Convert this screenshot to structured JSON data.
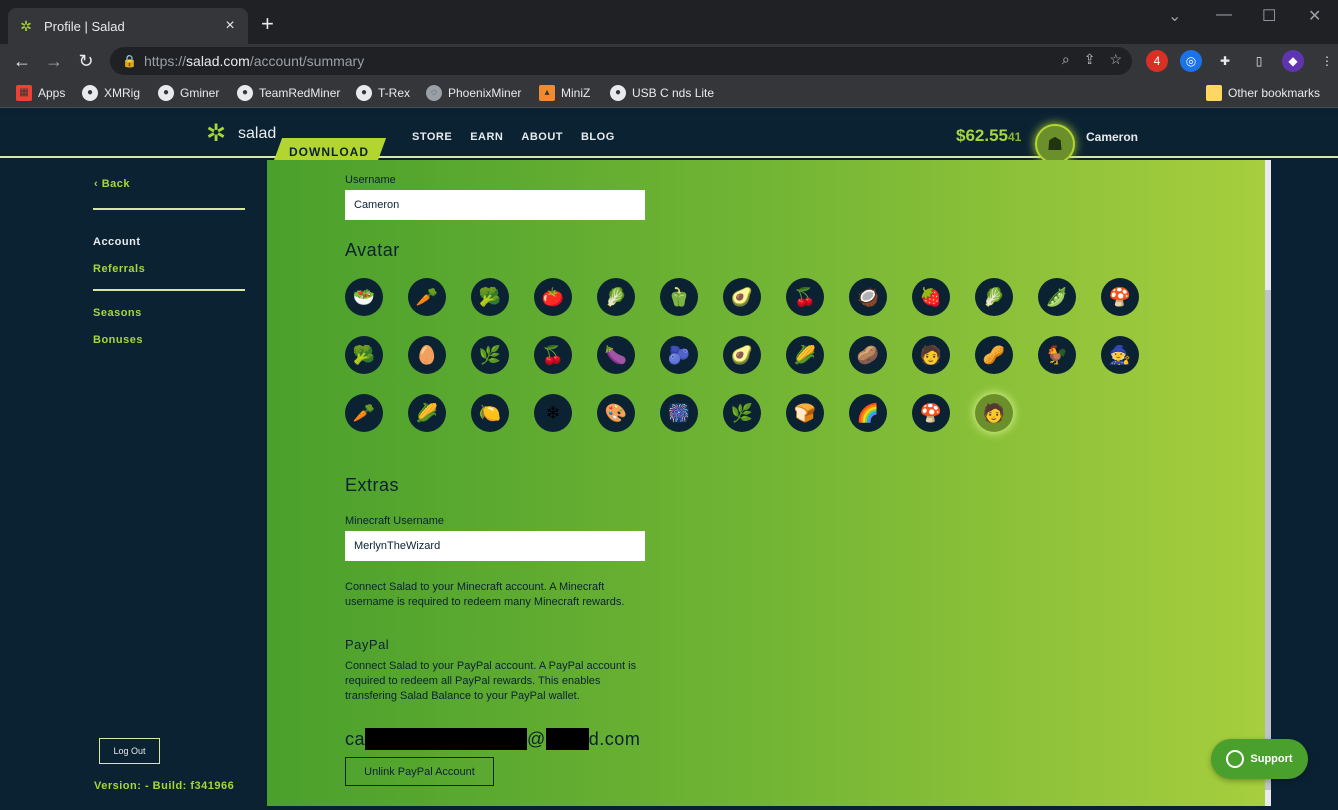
{
  "browser": {
    "tab_title": "Profile | Salad",
    "url_prefix": "https://",
    "url_domain": "salad.com",
    "url_path": "/account/summary",
    "bookmarks": [
      "Apps",
      "XMRig",
      "Gminer",
      "TeamRedMiner",
      "T-Rex",
      "PhoenixMiner",
      "MiniZ",
      "USB C nds Lite"
    ],
    "other_bookmarks": "Other bookmarks",
    "ext_badge": "4"
  },
  "header": {
    "logo_text": "salad",
    "download_label": "DOWNLOAD",
    "nav": [
      "STORE",
      "EARN",
      "ABOUT",
      "BLOG"
    ],
    "balance_main": "$62.55",
    "balance_fraction": "41",
    "username": "Cameron"
  },
  "sidebar": {
    "back_label": "Back",
    "items": [
      "Account",
      "Referrals",
      "Seasons",
      "Bonuses"
    ],
    "logout_label": "Log Out",
    "version": "Version: - Build: f341966"
  },
  "profile": {
    "username_label": "Username",
    "username_value": "Cameron",
    "avatar_heading": "Avatar",
    "avatars": [
      "🥗",
      "🥕",
      "🥦",
      "🍅",
      "🥬",
      "🫑",
      "🥑",
      "🍒",
      "🥥",
      "🍓",
      "🥬",
      "🫛",
      "🍄",
      "🥦",
      "🥚",
      "🌿",
      "🍒",
      "🍆",
      "🫐",
      "🥑",
      "🌽",
      "🥔",
      "🧑",
      "🥜",
      "🐓",
      "🧙",
      "🥕",
      "🌽",
      "🍋",
      "❄",
      "🎨",
      "🎆",
      "🌿",
      "🍞",
      "🌈",
      "🍄",
      "🧑"
    ],
    "selected_avatar_index": 36,
    "extras_heading": "Extras",
    "minecraft_label": "Minecraft Username",
    "minecraft_value": "MerlynTheWizard",
    "minecraft_help": "Connect Salad to your Minecraft account. A Minecraft username is required to redeem many Minecraft rewards.",
    "paypal_heading": "PayPal",
    "paypal_help": "Connect Salad to your PayPal account. A PayPal account is required to redeem all PayPal rewards. This enables transfering Salad Balance to your PayPal wallet.",
    "email_start": "ca",
    "email_at": "@",
    "email_end": "d.com",
    "unlink_label": "Unlink PayPal Account"
  },
  "support_label": "Support"
}
